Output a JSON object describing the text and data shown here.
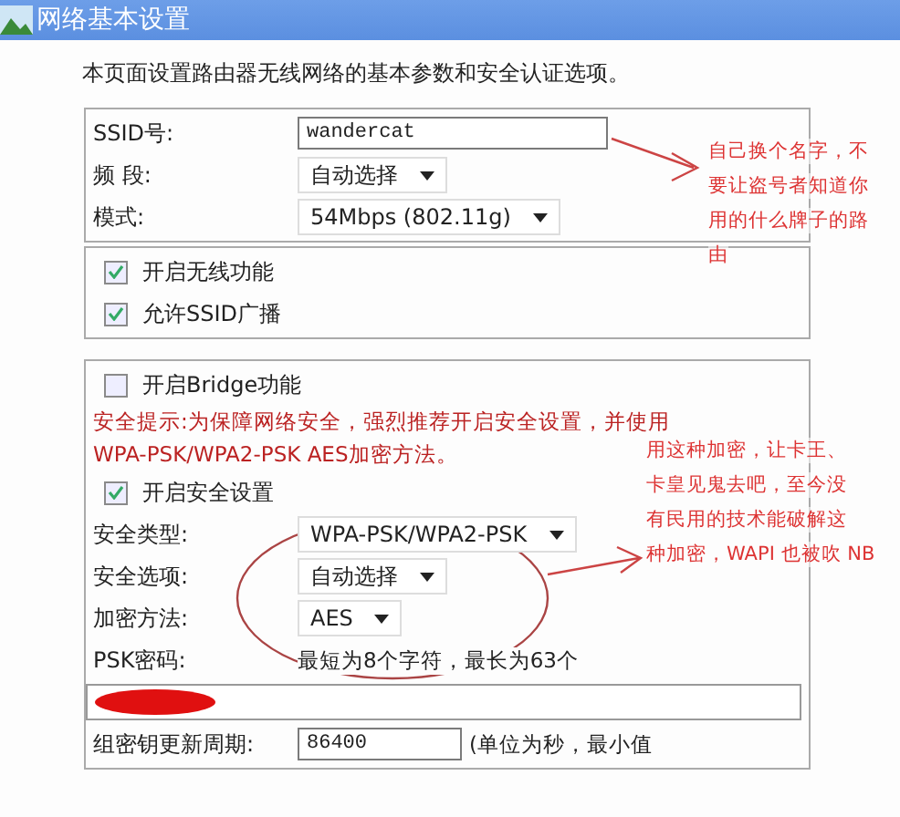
{
  "window": {
    "title": "网络基本设置"
  },
  "intro": "本页面设置路由器无线网络的基本参数和安全认证选项。",
  "basic": [
    {
      "kind": "input",
      "label": "SSID号:",
      "value": "wandercat"
    },
    {
      "kind": "select",
      "label": "频 段:",
      "value": "自动选择"
    },
    {
      "kind": "select",
      "label": "模式:",
      "value": "54Mbps (802.11g)"
    }
  ],
  "switches": [
    {
      "label": "开启无线功能",
      "checked": true
    },
    {
      "label": "允许SSID广播",
      "checked": true
    }
  ],
  "bridge": {
    "label": "开启Bridge功能",
    "checked": false
  },
  "tip": [
    "安全提示:为保障网络安全，强烈推荐开启安全设置，并使用",
    "WPA-PSK/WPA2-PSK AES加密方法。"
  ],
  "security_enable": {
    "label": "开启安全设置",
    "checked": true
  },
  "security": [
    {
      "kind": "select",
      "label": "安全类型:",
      "value": "WPA-PSK/WPA2-PSK"
    },
    {
      "kind": "select",
      "label": "安全选项:",
      "value": "自动选择"
    },
    {
      "kind": "select",
      "label": "加密方法:",
      "value": "AES"
    },
    {
      "kind": "hint",
      "label": "PSK密码:",
      "value": "最短为8个字符，最长为63个"
    },
    {
      "kind": "redacted"
    },
    {
      "kind": "input",
      "label": "组密钥更新周期:",
      "value": "86400",
      "note": "(单位为秒，最小值"
    }
  ],
  "annotations": [
    {
      "lines": [
        "自己换个名字，不",
        "要让盗号者知道你",
        "用的什么牌子的路",
        "由"
      ]
    },
    {
      "lines": [
        "用这种加密，让卡王、",
        "卡皇见鬼去吧，至今没",
        "有民用的技术能破解这",
        "种加密，WAPI 也被吹 NB"
      ]
    }
  ]
}
